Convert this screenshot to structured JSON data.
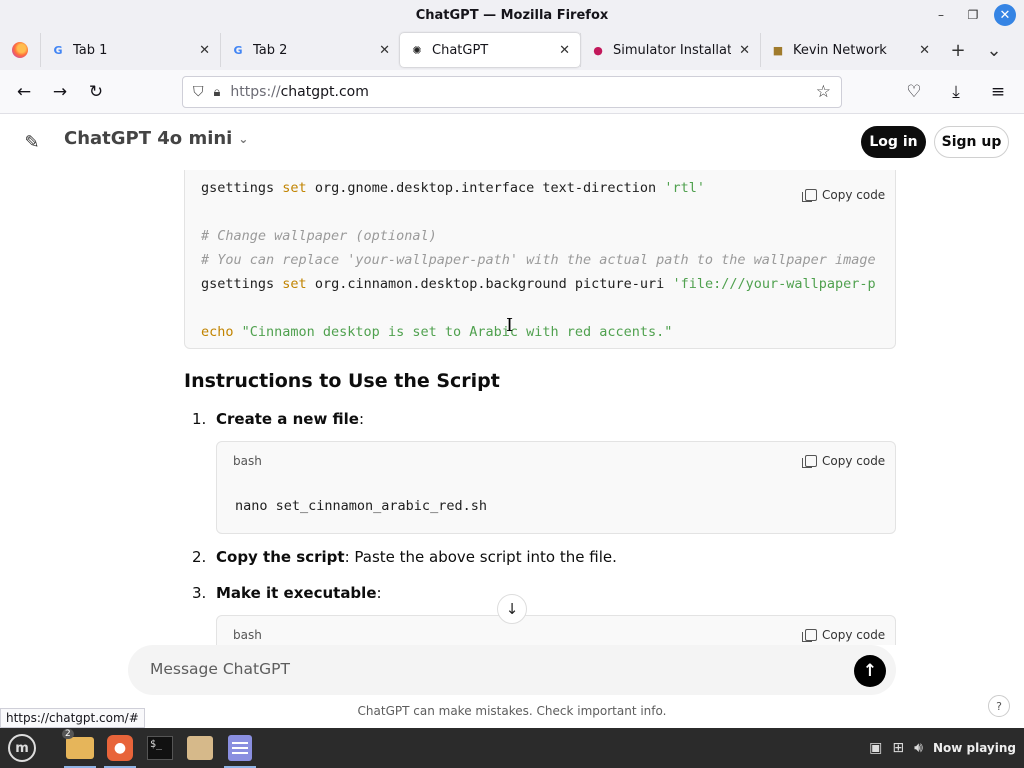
{
  "window": {
    "title": "ChatGPT — Mozilla Firefox"
  },
  "tabs": [
    {
      "label": "Tab 1",
      "favicon": "G"
    },
    {
      "label": "Tab 2",
      "favicon": "G"
    },
    {
      "label": "ChatGPT",
      "favicon": "✺"
    },
    {
      "label": "Simulator Installatio",
      "favicon": "●"
    },
    {
      "label": "Kevin Network",
      "favicon": "■"
    }
  ],
  "nav": {
    "url_scheme": "https://",
    "url_host": "chatgpt.com"
  },
  "header": {
    "model": "ChatGPT 4o mini",
    "login": "Log in",
    "signup": "Sign up"
  },
  "code_main": {
    "copy_label": "Copy code",
    "l1_cmd": "gsettings",
    "l1_kw": "set",
    "l1_rest": " org.gnome.desktop.interface text-direction ",
    "l1_str": "'rtl'",
    "l3": "# Change wallpaper (optional)",
    "l4": "# You can replace 'your-wallpaper-path' with the actual path to the wallpaper image",
    "l5_cmd": "gsettings",
    "l5_kw": "set",
    "l5_rest": " org.cinnamon.desktop.background picture-uri ",
    "l5_str": "'file:///your-wallpaper-p",
    "l7_kw": "echo",
    "l7_str": " \"Cinnamon desktop is set to Arabic with red accents.\""
  },
  "instructions": {
    "heading": "Instructions to Use the Script",
    "steps": [
      {
        "num": "1.",
        "bold": "Create a new file",
        "rest": ":"
      },
      {
        "num": "2.",
        "bold": "Copy the script",
        "rest": ": Paste the above script into the file."
      },
      {
        "num": "3.",
        "bold": "Make it executable",
        "rest": ":"
      }
    ],
    "block1": {
      "lang": "bash",
      "copy": "Copy code",
      "cmd": "nano set_cinnamon_arabic_red.sh"
    },
    "block2": {
      "lang": "bash",
      "copy": "Copy code"
    }
  },
  "composer": {
    "placeholder": "Message ChatGPT"
  },
  "disclaimer": "ChatGPT can make mistakes. Check important info.",
  "help": "?",
  "status_link": "https://chatgpt.com/#",
  "taskbar": {
    "badge": "2",
    "now_playing": "Now playing"
  }
}
